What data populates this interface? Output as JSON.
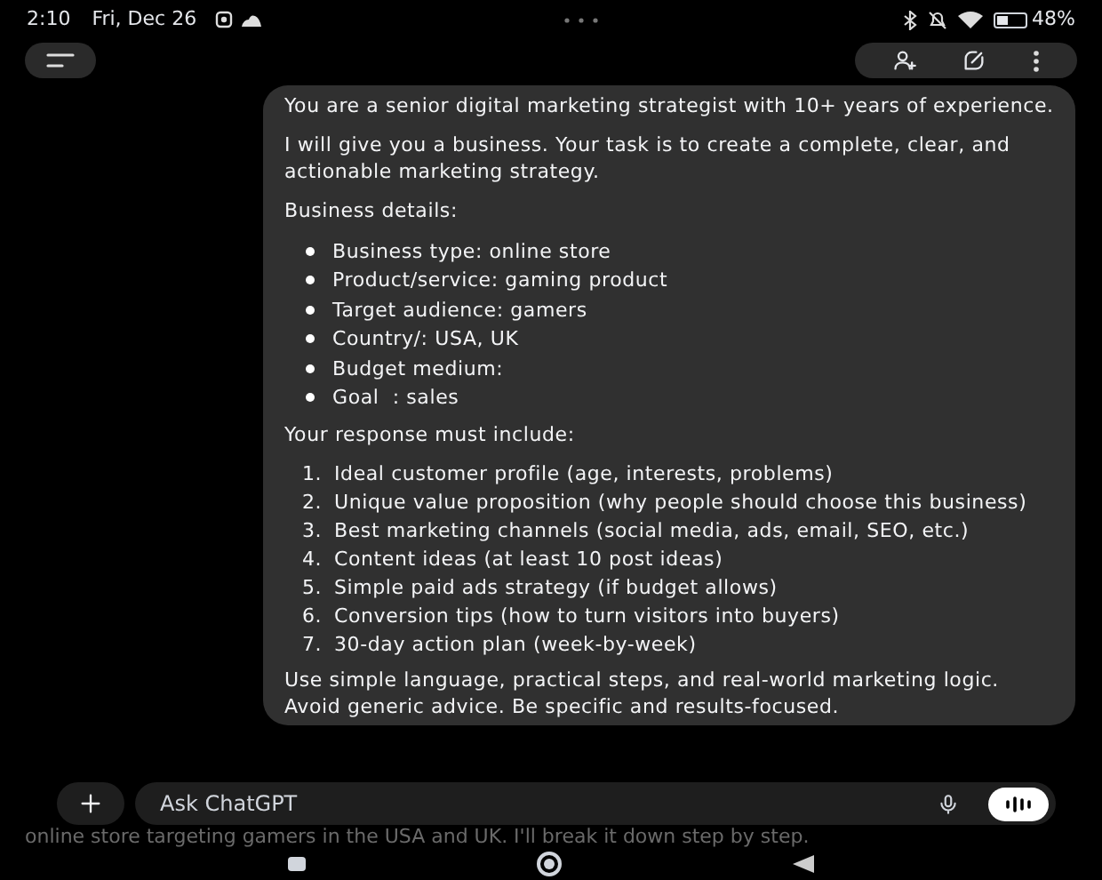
{
  "status_bar": {
    "time": "2:10",
    "date": "Fri, Dec 26",
    "battery": "48%"
  },
  "message": {
    "blocks": [
      {
        "kind": "paragraph",
        "text": "You are a senior digital marketing strategist with 10+ years of experience."
      },
      {
        "kind": "paragraph",
        "text": "I will give you a business. Your task is to create a complete, clear, and actionable marketing strategy."
      },
      {
        "kind": "paragraph",
        "text": "Business details:"
      },
      {
        "kind": "bullets",
        "items": [
          "Business type: online store",
          "Product/service: gaming product",
          "Target audience: gamers",
          "Country/: USA, UK",
          "Budget medium:",
          "Goal  : sales"
        ]
      },
      {
        "kind": "paragraph",
        "text": "Your response must include:"
      },
      {
        "kind": "numbered",
        "items": [
          {
            "number": "1.",
            "text": "Ideal customer profile (age, interests, problems)"
          },
          {
            "number": "2.",
            "text": "Unique value proposition (why people should choose this business)"
          },
          {
            "number": "3.",
            "text": "Best marketing channels (social media, ads, email, SEO, etc.)"
          },
          {
            "number": "4.",
            "text": "Content ideas (at least 10 post ideas)"
          },
          {
            "number": "5.",
            "text": "Simple paid ads strategy (if budget allows)"
          },
          {
            "number": "6.",
            "text": "Conversion tips (how to turn visitors into buyers)"
          },
          {
            "number": "7.",
            "text": "30-day action plan (week-by-week)"
          }
        ]
      },
      {
        "kind": "lines",
        "items": [
          "Use simple language, practical steps, and real-world marketing logic.",
          "Avoid generic advice. Be specific and results-focused."
        ]
      }
    ]
  },
  "reply_preview": "online store targeting gamers in the USA and UK. I'll break it down step by step.",
  "composer": {
    "placeholder": "Ask ChatGPT"
  }
}
